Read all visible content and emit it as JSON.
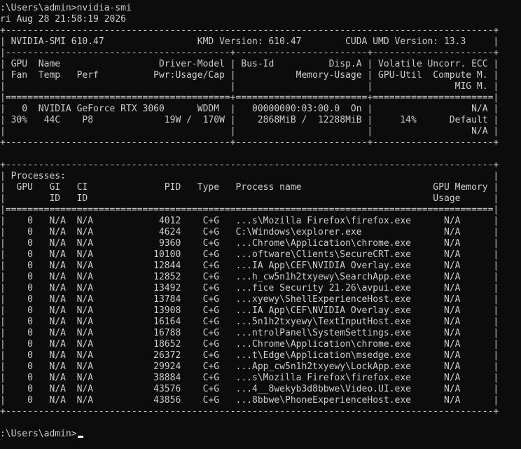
{
  "terminal": {
    "lines": [
      ":\\Users\\admin>nvidia-smi",
      "ri Aug 28 21:58:19 2026",
      "+-----------------------------------------------------------------------------------------+",
      "| NVIDIA-SMI 610.47                 KMD Version: 610.47        CUDA UMD Version: 13.3     |",
      "|-----------------------------------------+------------------------+----------------------+",
      "| GPU  Name                  Driver-Model | Bus-Id          Disp.A | Volatile Uncorr. ECC |",
      "| Fan  Temp   Perf          Pwr:Usage/Cap |           Memory-Usage | GPU-Util  Compute M. |",
      "|                                         |                        |               MIG M. |",
      "|=========================================+========================+======================|",
      "|   0  NVIDIA GeForce RTX 3060      WDDM  |   00000000:03:00.0  On |                  N/A |",
      "| 30%   44C    P8             19W /  170W |    2868MiB /  12288MiB |     14%      Default |",
      "|                                         |                        |                  N/A |",
      "+-----------------------------------------+------------------------+----------------------+",
      "",
      "+-----------------------------------------------------------------------------------------+",
      "| Processes:                                                                              |",
      "|  GPU   GI   CI              PID   Type   Process name                        GPU Memory |",
      "|        ID   ID                                                               Usage      |",
      "|=========================================================================================|",
      "|    0   N/A  N/A            4012    C+G   ...s\\Mozilla Firefox\\firefox.exe      N/A      |",
      "|    0   N/A  N/A            4624    C+G   C:\\Windows\\explorer.exe               N/A      |",
      "|    0   N/A  N/A            9360    C+G   ...Chrome\\Application\\chrome.exe      N/A      |",
      "|    0   N/A  N/A           10100    C+G   ...oftware\\Clients\\SecureCRT.exe      N/A      |",
      "|    0   N/A  N/A           12844    C+G   ...IA App\\CEF\\NVIDIA Overlay.exe      N/A      |",
      "|    0   N/A  N/A           12852    C+G   ...h_cw5n1h2txyewy\\SearchApp.exe      N/A      |",
      "|    0   N/A  N/A           13492    C+G   ...fice Security 21.26\\avpui.exe      N/A      |",
      "|    0   N/A  N/A           13784    C+G   ...xyewy\\ShellExperienceHost.exe      N/A      |",
      "|    0   N/A  N/A           13908    C+G   ...IA App\\CEF\\NVIDIA Overlay.exe      N/A      |",
      "|    0   N/A  N/A           16164    C+G   ...5n1h2txyewy\\TextInputHost.exe      N/A      |",
      "|    0   N/A  N/A           16788    C+G   ...ntrolPanel\\SystemSettings.exe      N/A      |",
      "|    0   N/A  N/A           18652    C+G   ...Chrome\\Application\\chrome.exe      N/A      |",
      "|    0   N/A  N/A           26372    C+G   ...t\\Edge\\Application\\msedge.exe      N/A      |",
      "|    0   N/A  N/A           29924    C+G   ...App_cw5n1h2txyewy\\LockApp.exe      N/A      |",
      "|    0   N/A  N/A           38884    C+G   ...s\\Mozilla Firefox\\firefox.exe      N/A      |",
      "|    0   N/A  N/A           43576    C+G   ...4__8wekyb3d8bbwe\\Video.UI.exe      N/A      |",
      "|    0   N/A  N/A           43856    C+G   ...8bbwe\\PhoneExperienceHost.exe      N/A      |",
      "+-----------------------------------------------------------------------------------------+",
      ""
    ],
    "prompt": ":\\Users\\admin>",
    "colors": {
      "background": "#0c0c0c",
      "text": "#cccccc",
      "cursor": "#ffffff"
    }
  }
}
